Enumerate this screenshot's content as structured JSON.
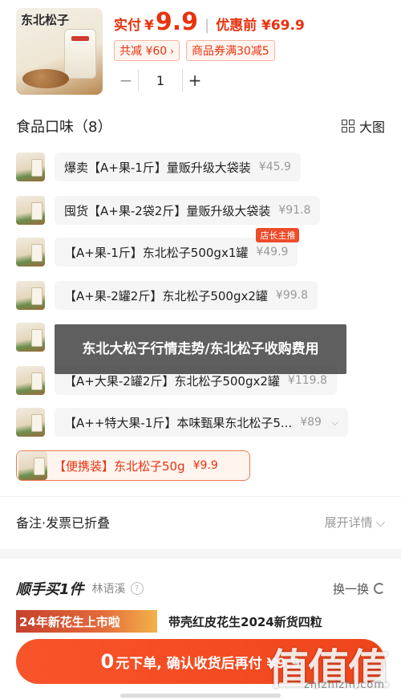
{
  "product": {
    "image_brand_text": "东北松子",
    "pay_label": "实付",
    "currency": "¥",
    "pay_amount": "9.9",
    "original_label": "优惠前 ¥69.9",
    "discount_tag": "共减 ¥60",
    "coupon_tag": "商品券满30减5",
    "quantity": "1"
  },
  "flavor": {
    "title": "食品口味（8）",
    "view_toggle": "大图"
  },
  "variants": [
    {
      "name": "爆卖【A+果-1斤】量贩升级大袋装",
      "price": "¥45.9"
    },
    {
      "name": "囤货【A+果-2袋2斤】量贩升级大袋装",
      "price": "¥91.8"
    },
    {
      "name": "【A+果-1斤】东北松子500gx1罐",
      "price": "¥49.9",
      "badge": "店长主推"
    },
    {
      "name": "【A+果-2罐2斤】东北松子500gx2罐",
      "price": "¥99.8"
    },
    {
      "name": "【A+大果-2罐2斤】东北松子500gx2罐",
      "price": "¥119.8"
    },
    {
      "name": "【A++特大果-1斤】本味甄果东北松子5...",
      "price": "¥89"
    },
    {
      "name": "【便携装】东北松子50g",
      "price": "¥9.9"
    }
  ],
  "overlay": {
    "text": "东北大松子行情走势/东北松子收购费用"
  },
  "remarks": {
    "label": "备注·发票已折叠",
    "expand": "展开详情"
  },
  "buy_along": {
    "title": "顺手买1件",
    "user": "林语溪",
    "refresh": "换一换",
    "banner_text": "24年新花生上市啦",
    "item_name": "带壳红皮花生2024新货四粒"
  },
  "cta": {
    "amount": "0",
    "text": "元下单, 确认收货后再付 ¥9.9"
  },
  "watermark": {
    "logo": "值值值",
    "url": "zhizhizhi.com"
  },
  "colors": {
    "accent": "#e8330f",
    "cta": "#f54e25",
    "badge": "#ee4b2b"
  }
}
